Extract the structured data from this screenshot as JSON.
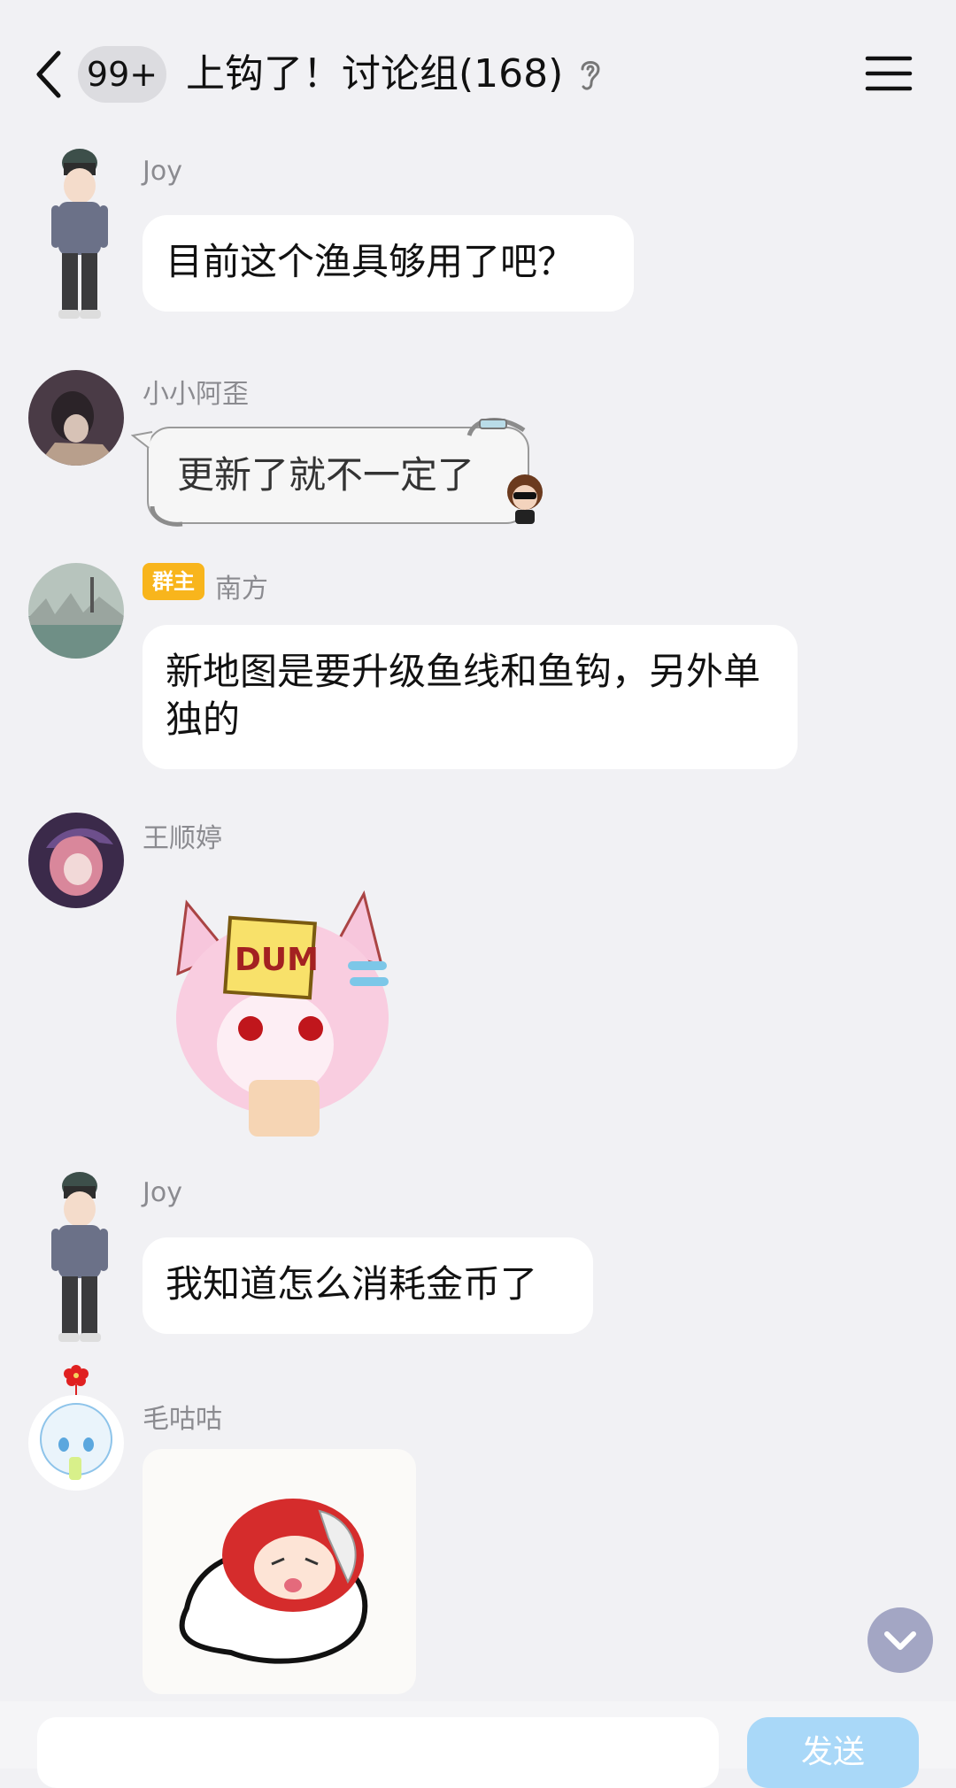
{
  "header": {
    "unread_count": "99+",
    "title": "上钩了！讨论组(168)"
  },
  "messages": [
    {
      "sender": "Joy",
      "text": "目前这个渔具够用了吧？"
    },
    {
      "sender": "小小阿歪",
      "text": "更新了就不一定了"
    },
    {
      "sender": "南方",
      "badge": "群主",
      "text": "新地图是要升级鱼线和鱼钩，另外单独的"
    },
    {
      "sender": "王顺婷",
      "sticker": "DUM"
    },
    {
      "sender": "Joy",
      "text": "我知道怎么消耗金币了"
    },
    {
      "sender": "毛咕咕",
      "sticker": ""
    }
  ],
  "input": {
    "send_label": "发送"
  },
  "colors": {
    "background": "#f1f1f4",
    "bubble": "#ffffff",
    "owner_badge": "#f8b51c",
    "send_button": "#a9d8f8",
    "scroll_button": "#a3a6c4"
  }
}
